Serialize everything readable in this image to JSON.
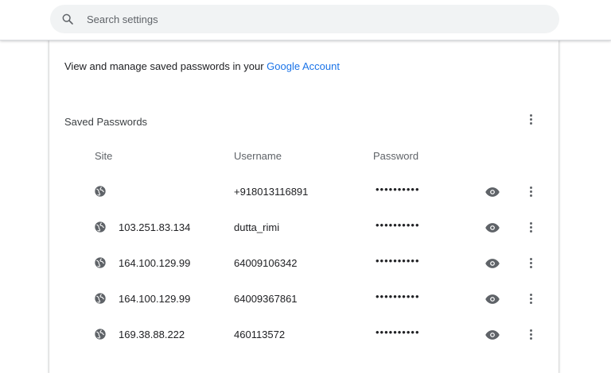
{
  "search": {
    "placeholder": "Search settings",
    "icon": "search-icon"
  },
  "manage": {
    "text": "View and manage saved passwords in your ",
    "link": "Google Account"
  },
  "saved_passwords": {
    "title": "Saved Passwords",
    "columns": {
      "site": "Site",
      "username": "Username",
      "password": "Password"
    },
    "rows": [
      {
        "site": "",
        "username": "+918013116891",
        "password": "••••••••••"
      },
      {
        "site": "103.251.83.134",
        "username": "dutta_rimi",
        "password": "••••••••••"
      },
      {
        "site": "164.100.129.99",
        "username": "64009106342",
        "password": "••••••••••"
      },
      {
        "site": "164.100.129.99",
        "username": "64009367861",
        "password": "••••••••••"
      },
      {
        "site": "169.38.88.222",
        "username": "460113572",
        "password": "••••••••••"
      }
    ]
  },
  "colors": {
    "link": "#1a73e8",
    "icon": "#5f6368"
  }
}
